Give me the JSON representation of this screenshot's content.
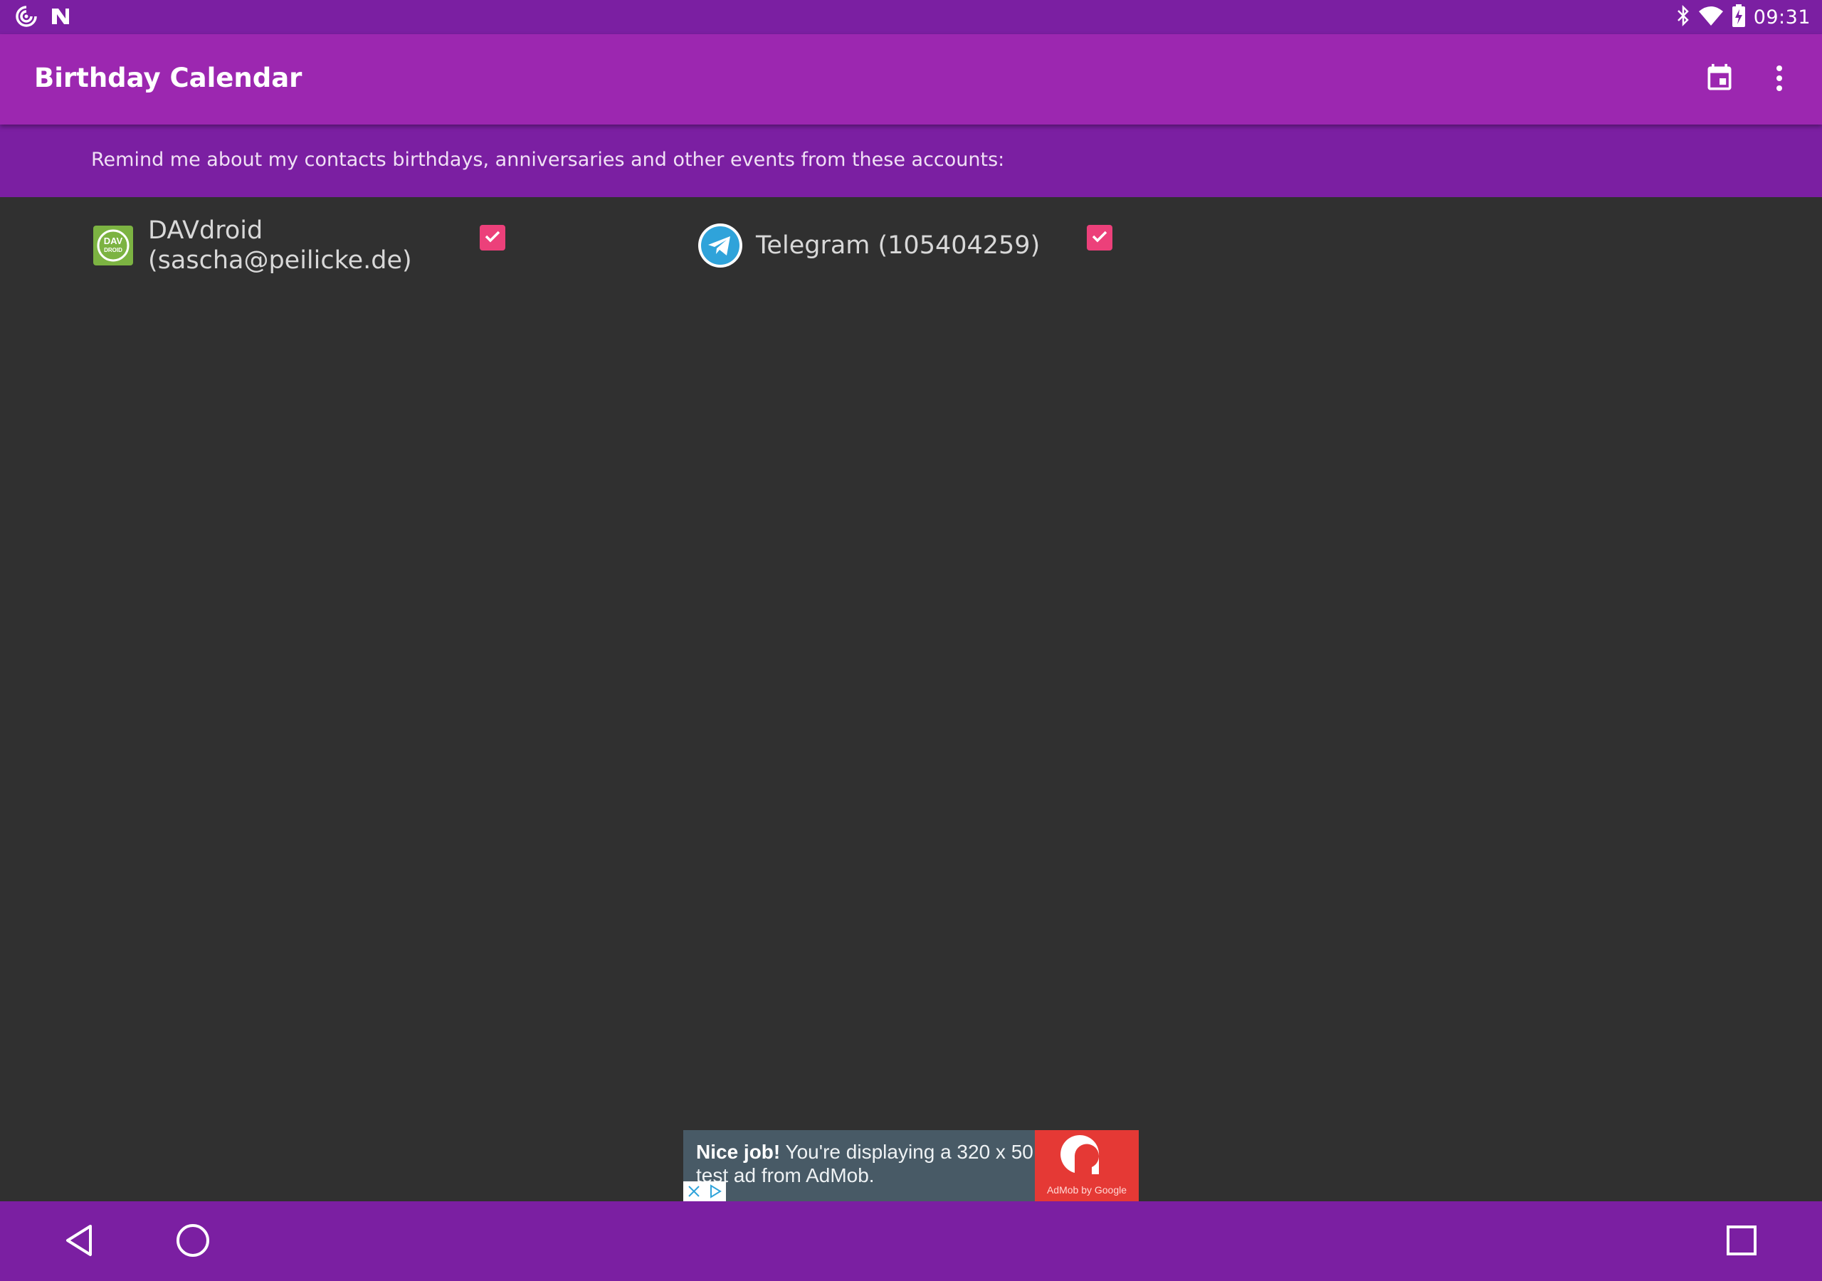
{
  "status_bar": {
    "time": "09:31",
    "left_icons": [
      "sync-icon",
      "n-icon"
    ],
    "right_icons": [
      "bluetooth-icon",
      "wifi-icon",
      "battery-charging-icon"
    ]
  },
  "toolbar": {
    "title": "Birthday Calendar",
    "actions": [
      "calendar-icon",
      "more-vert-icon"
    ]
  },
  "subheader": {
    "text": "Remind me about my contacts birthdays, anniversaries and other events from these accounts:"
  },
  "accounts": [
    {
      "name_line1": "DAVdroid",
      "name_line2": "(sascha@peilicke.de)",
      "icon": "davdroid-icon",
      "checked": true
    },
    {
      "name": "Telegram (105404259)",
      "icon": "telegram-icon",
      "checked": true
    }
  ],
  "ad": {
    "bold": "Nice job!",
    "text": " You're displaying a 320 x 50 test ad from AdMob.",
    "logo_caption": "AdMob by Google"
  },
  "nav_bar": {
    "buttons": [
      "back-icon",
      "home-icon",
      "recents-icon"
    ]
  },
  "colors": {
    "primary": "#9c27b0",
    "primary_dark": "#7b1fa2",
    "accent": "#ec407a",
    "background": "#303030"
  }
}
